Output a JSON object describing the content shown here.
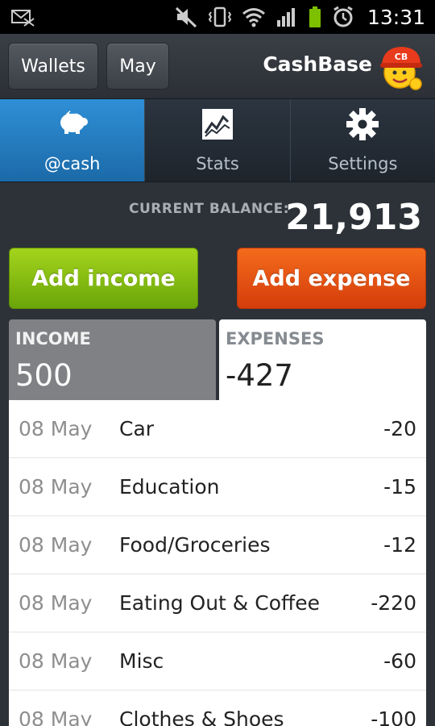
{
  "status_bar": {
    "time": "13:31",
    "icons": [
      "sms-icon",
      "mute-icon",
      "vibrate-icon",
      "wifi-icon",
      "signal-icon",
      "battery-icon",
      "alarm-icon"
    ]
  },
  "header": {
    "wallets_label": "Wallets",
    "month_label": "May",
    "app_title": "CashBase",
    "logo_badge": "CB"
  },
  "tabs": [
    {
      "label": "@cash",
      "icon": "piggy-bank-icon",
      "active": true
    },
    {
      "label": "Stats",
      "icon": "chart-icon",
      "active": false
    },
    {
      "label": "Settings",
      "icon": "gear-icon",
      "active": false
    }
  ],
  "balance": {
    "label": "CURRENT BALANCE:",
    "value": "21,913"
  },
  "actions": {
    "add_income": "Add income",
    "add_expense": "Add expense"
  },
  "summary": {
    "income_label": "INCOME",
    "income_value": "500",
    "expenses_label": "EXPENSES",
    "expenses_value": "-427"
  },
  "transactions": [
    {
      "date": "08 May",
      "category": "Car",
      "amount": "-20"
    },
    {
      "date": "08 May",
      "category": "Education",
      "amount": "-15"
    },
    {
      "date": "08 May",
      "category": "Food/Groceries",
      "amount": "-12"
    },
    {
      "date": "08 May",
      "category": "Eating Out & Coffee",
      "amount": "-220"
    },
    {
      "date": "08 May",
      "category": "Misc",
      "amount": "-60"
    },
    {
      "date": "08 May",
      "category": "Clothes & Shoes",
      "amount": "-100"
    }
  ],
  "colors": {
    "accent_tab": "#2f8fd6",
    "income_button": "#8cc417",
    "expense_button": "#e8530f"
  }
}
